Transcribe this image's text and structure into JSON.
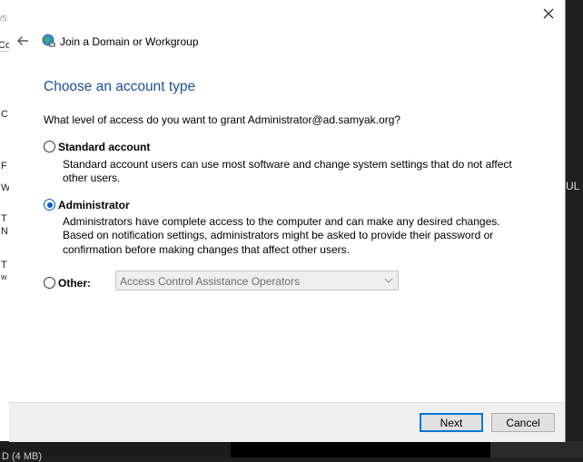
{
  "background": {
    "left_fragments": [
      "ys",
      "Co",
      "C",
      "F",
      "W",
      "T",
      "N",
      "T",
      "w"
    ],
    "bottom_text": "D (4 MB)",
    "right_fragment": "UL"
  },
  "dialog": {
    "title": "Join a Domain or Workgroup",
    "heading": "Choose an account type",
    "question": "What level of access do you want to grant Administrator@ad.samyak.org?",
    "options": [
      {
        "label": "Standard account",
        "checked": false,
        "description": "Standard account users can use most software and change system settings that do not affect other users."
      },
      {
        "label": "Administrator",
        "checked": true,
        "description": "Administrators have complete access to the computer and can make any desired changes. Based on notification settings, administrators might be asked to provide their password or confirmation before making changes that affect other users."
      },
      {
        "label": "Other:",
        "checked": false,
        "description": ""
      }
    ],
    "other_select_value": "Access Control Assistance Operators",
    "buttons": {
      "next": "Next",
      "cancel": "Cancel"
    }
  },
  "colors": {
    "heading": "#1f4e99",
    "accent": "#0078d7"
  }
}
